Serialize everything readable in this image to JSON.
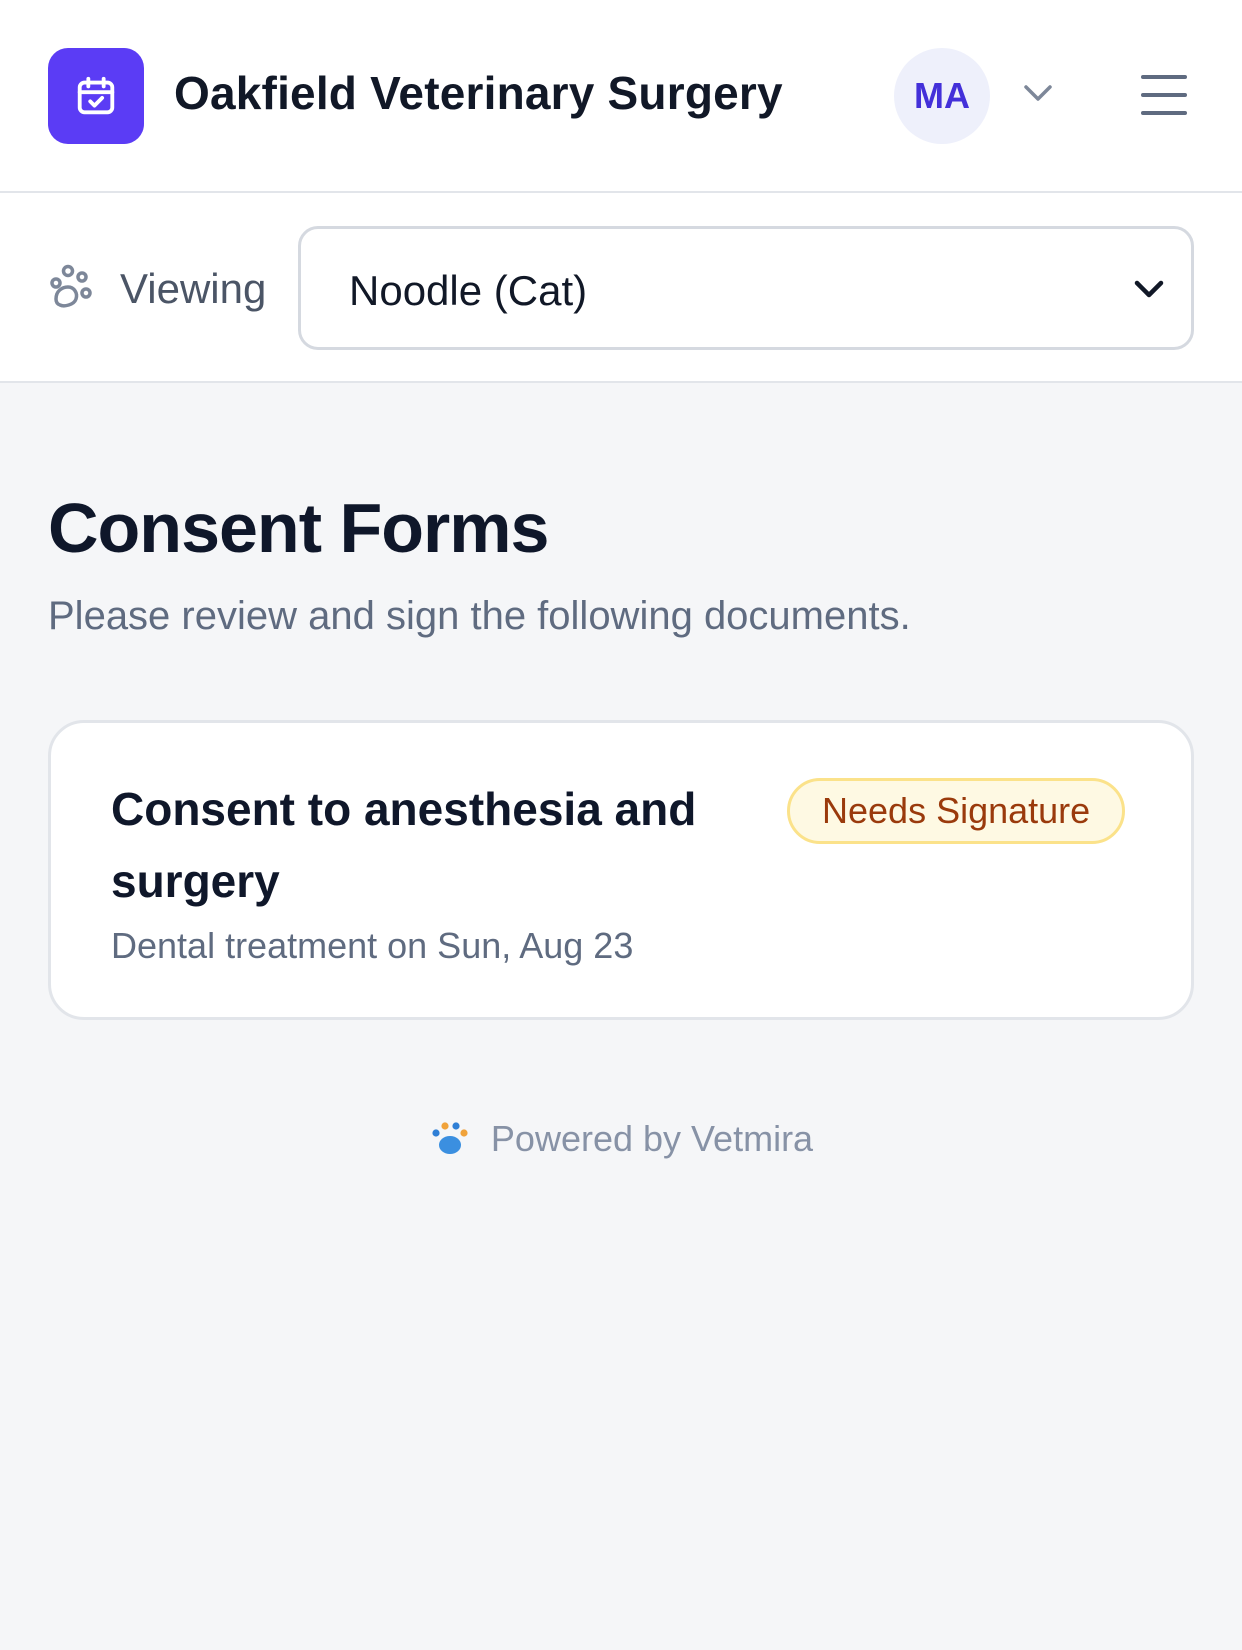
{
  "header": {
    "clinic_name": "Oakfield Veterinary Surgery",
    "avatar_initials": "MA",
    "brand_color": "#5b3cf5"
  },
  "viewing": {
    "label": "Viewing",
    "selected_pet": "Noodle (Cat)"
  },
  "main": {
    "title": "Consent Forms",
    "subtitle": "Please review and sign the following documents.",
    "forms": [
      {
        "title": "Consent to anesthesia and surgery",
        "meta": "Dental treatment on Sun, Aug 23",
        "status": "Needs Signature"
      }
    ]
  },
  "footer": {
    "powered_by": "Powered by Vetmira"
  },
  "icons": {
    "logo": "calendar-check-icon",
    "avatar_menu": "chevron-down-icon",
    "menu": "hamburger-menu-icon",
    "viewing": "paws-icon",
    "select": "chevron-down-icon",
    "footer": "paw-icon"
  }
}
